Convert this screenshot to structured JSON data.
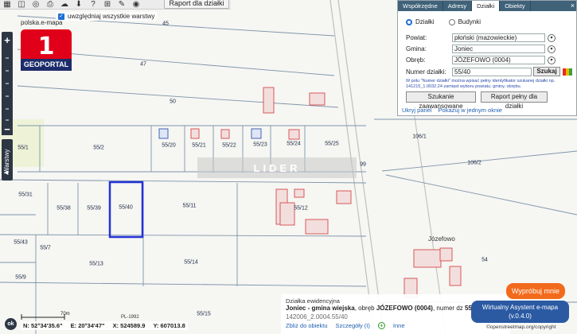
{
  "toolbar": {
    "icons": [
      "layers-icon",
      "map-icon",
      "globe-icon",
      "print-icon",
      "upload-icon",
      "download-icon",
      "help-icon",
      "grid-icon",
      "tools-icon",
      "camera-icon"
    ],
    "report_label": "Raport dla działki"
  },
  "site_name": "polska.e-mapa",
  "layers_checkbox_label": "uwzględniaj wszystkie warstwy",
  "left_strip": {
    "zoom_in": "+",
    "zoom_out": "−",
    "layers_tab": "Warstwy"
  },
  "logo": {
    "number": "1",
    "text": "GEOPORTAL",
    "colors": {
      "top": "#e1001a",
      "bottom": "#1c2c6b"
    }
  },
  "watermark": "LIDER",
  "map": {
    "parcel_labels": [
      {
        "text": "45"
      },
      {
        "text": "47"
      },
      {
        "text": "50"
      },
      {
        "text": "55/1"
      },
      {
        "text": "55/2"
      },
      {
        "text": "55/20"
      },
      {
        "text": "55/21"
      },
      {
        "text": "55/22"
      },
      {
        "text": "55/23"
      },
      {
        "text": "55/24"
      },
      {
        "text": "55/25"
      },
      {
        "text": "55/31"
      },
      {
        "text": "55/38"
      },
      {
        "text": "55/39"
      },
      {
        "text": "55/40"
      },
      {
        "text": "55/11"
      },
      {
        "text": "55/12"
      },
      {
        "text": "55/43"
      },
      {
        "text": "55/7"
      },
      {
        "text": "55/13"
      },
      {
        "text": "55/14"
      },
      {
        "text": "55/9"
      },
      {
        "text": "106/1"
      },
      {
        "text": "106/2"
      },
      {
        "text": "99"
      },
      {
        "text": "54"
      },
      {
        "text": "55/15"
      }
    ],
    "place_label": "Józefowo",
    "selected_parcel_color": "#2432d6",
    "building_color": "#d44a4a"
  },
  "panel": {
    "tabs": [
      "Współrzędne",
      "Adresy",
      "Działki",
      "Obiekty"
    ],
    "active_tab": "Działki",
    "close": "×",
    "radio_dzialki": "Działki",
    "radio_budynki": "Budynki",
    "powiat_label": "Powiat:",
    "powiat_value": "płoński (mazowieckie)",
    "gmina_label": "Gmina:",
    "gmina_value": "Joniec",
    "obreb_label": "Obręb:",
    "obreb_value": "JÓZEFOWO (0004)",
    "numer_label": "Numer działki:",
    "numer_value": "55/40",
    "search_btn": "Szukaj",
    "hint": "W polu \"Numer działki\" można wpisać pełny identyfikator szukanej działki np. 141215_1.0032.24 zamiast wyboru powiatu, gminy, obrębu.",
    "btn_advanced": "Szukanie zaawansowane",
    "btn_full_report": "Raport pełny dla działki",
    "link_hide": "Ukryj panel",
    "link_one_window": "Pokazuj w jednym oknie",
    "swatches": [
      "#e0301e",
      "#f0b400",
      "#3aa13a"
    ]
  },
  "info": {
    "title": "Działka ewidencyjna",
    "line_bold": "Joniec - gmina wiejska",
    "line_rest": ", obręb ",
    "obreb_bold": "JÓZEFOWO (0004)",
    "numer_text": ", numer dz ",
    "numer_bold": "55/",
    "id": "142006_2.0004.55/40",
    "zoom_link": "Zbliż do obiektu",
    "details_link": "Szczegóły (I)",
    "other_link": "Inne"
  },
  "try_button": "Wypróbuj mnie",
  "assistant": {
    "line1": "Wirtualny Asystent e-mapa",
    "line2": "(v.0.4.0)"
  },
  "osm_attribution": "©openstreetmap.org/copyright",
  "ok_button": "ok",
  "scale": {
    "length_label": "70m",
    "epsg": "PL-1992"
  },
  "coords": {
    "n": "N: 52°34'35.6\"",
    "e": "E: 20°34'47\"",
    "x": "X: 524589.9",
    "y": "Y: 607013.8"
  }
}
